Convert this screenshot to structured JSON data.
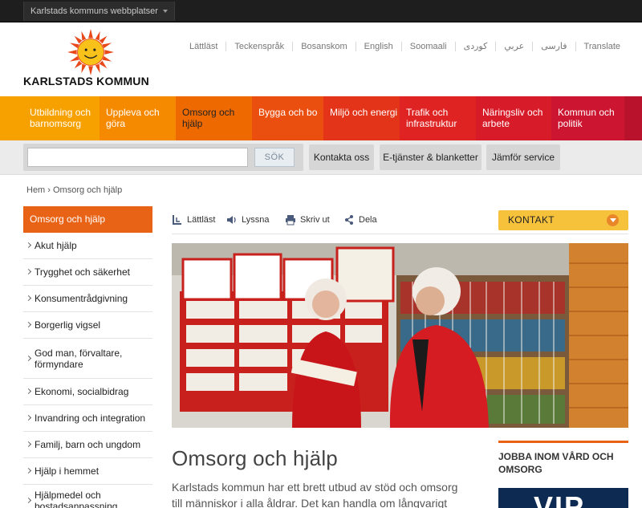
{
  "topbar": {
    "sites_label": "Karlstads kommuns webbplatser"
  },
  "header": {
    "logo_text": "KARLSTADS KOMMUN",
    "languages": [
      "Lättläst",
      "Teckenspråk",
      "Bosanskom",
      "English",
      "Soomaali",
      "کوردی",
      "عربي",
      "فارسی",
      "Translate"
    ]
  },
  "mainnav": [
    {
      "label": "Utbildning och barnomsorg",
      "color": "#f7a100"
    },
    {
      "label": "Uppleva och göra",
      "color": "#f58a00"
    },
    {
      "label": "Omsorg och hjälp",
      "color": "#ee6a00"
    },
    {
      "label": "Bygga och bo",
      "color": "#ea4f0f"
    },
    {
      "label": "Miljö och energi",
      "color": "#e3341a"
    },
    {
      "label": "Trafik och infrastruktur",
      "color": "#df2323"
    },
    {
      "label": "Näringsliv och arbete",
      "color": "#d81b28"
    },
    {
      "label": "Kommun och politik",
      "color": "#cc1530"
    }
  ],
  "search": {
    "placeholder": "",
    "button": "SÖK"
  },
  "quicklinks": [
    "Kontakta oss",
    "E-tjänster & blanketter",
    "Jämför service"
  ],
  "breadcrumb": "Hem › Omsorg och hjälp",
  "leftmenu": {
    "current": "Omsorg och hjälp",
    "items": [
      "Akut hjälp",
      "Trygghet och säkerhet",
      "Konsumentrådgivning",
      "Borgerlig vigsel",
      "God man, förvaltare, förmyndare",
      "Ekonomi, socialbidrag",
      "Invandring och integration",
      "Familj, barn och ungdom",
      "Hjälp i hemmet",
      "Hjälpmedel och bostadsanpassning"
    ]
  },
  "toolbar": {
    "easy": "Lättläst",
    "listen": "Lyssna",
    "print": "Skriv ut",
    "share": "Dela",
    "contact": "KONTAKT"
  },
  "content": {
    "title": "Omsorg och hjälp",
    "lead": "Karlstads kommun har ett brett utbud av stöd och omsorg till människor i alla åldrar. Det kan handla om långvarigt eller"
  },
  "sidebox": {
    "title": "JOBBA INOM VÅRD OCH OMSORG",
    "banner_text": "VIP"
  },
  "colors": {
    "accent": "#e96316",
    "kontakt": "#f7c23b",
    "topbar": "#1e1e1e"
  }
}
